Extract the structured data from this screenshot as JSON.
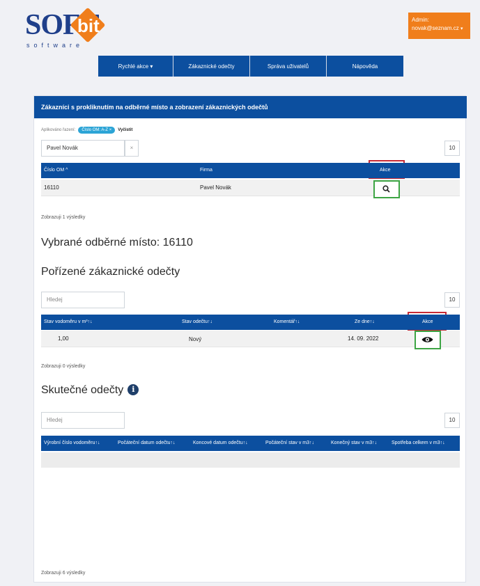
{
  "logo": {
    "brand_left": "SOFT",
    "brand_right": "bit",
    "subtitle": "software"
  },
  "admin": {
    "label": "Admin:",
    "email": "novak@seznam.cz",
    "caret": "▾"
  },
  "nav": {
    "items": [
      "Rychlé akce ▾",
      "Zákaznické odečty",
      "Správa uživatelů",
      "Nápověda"
    ]
  },
  "card": {
    "title": "Zákazníci s prokliknutím na odběrné místo a zobrazení zákaznických odečtů"
  },
  "customers": {
    "filter_label": "Aplikováno řazení:",
    "filter_chip": "Číslo OM: A-Z ×",
    "clear_label": "Vyčistit",
    "search_value": "Pavel Novák",
    "clear_button": "×",
    "page_size": "10",
    "columns": [
      "Číslo OM ^",
      "Firma",
      "Akce"
    ],
    "rows": [
      {
        "om": "16110",
        "firma": "Pavel Novák"
      }
    ],
    "result_text": "Zobrazuji 1 výsledky"
  },
  "selected": {
    "heading": "Vybrané odběrné místo: 16110"
  },
  "readings": {
    "heading": "Pořízené zákaznické odečty",
    "search_placeholder": "Hledej",
    "page_size": "10",
    "columns": [
      "Stav vodoměru v m³↑↓",
      "Stav odečtu↑↓",
      "Komentář↑↓",
      "Ze dne↑↓",
      "Akce"
    ],
    "rows": [
      {
        "stav": "1,00",
        "status": "Nový",
        "komentar": "",
        "date": "14. 09. 2022"
      }
    ],
    "result_text": "Zobrazuji 0 výsledky"
  },
  "actual": {
    "heading": "Skutečné odečty",
    "info_glyph": "i",
    "search_placeholder": "Hledej",
    "page_size": "10",
    "columns": [
      "Výrobní číslo vodoměru↑↓",
      "Počáteční datum odečtu↑↓",
      "Koncové datum odečtu↑↓",
      "Počáteční stav v m3↑↓",
      "Konečný stav v m3↑↓",
      "Spotřeba celkem v m3↑↓"
    ],
    "result_text": "Zobrazuji 6 výsledky"
  },
  "highlight_colors": {
    "red": "#c62a35",
    "green": "#3da544",
    "primary": "#0c4f9f",
    "accent": "#f07e1b"
  },
  "icons": {
    "view_customer": "search-icon",
    "view_reading": "eye-icon",
    "info": "info-icon"
  }
}
